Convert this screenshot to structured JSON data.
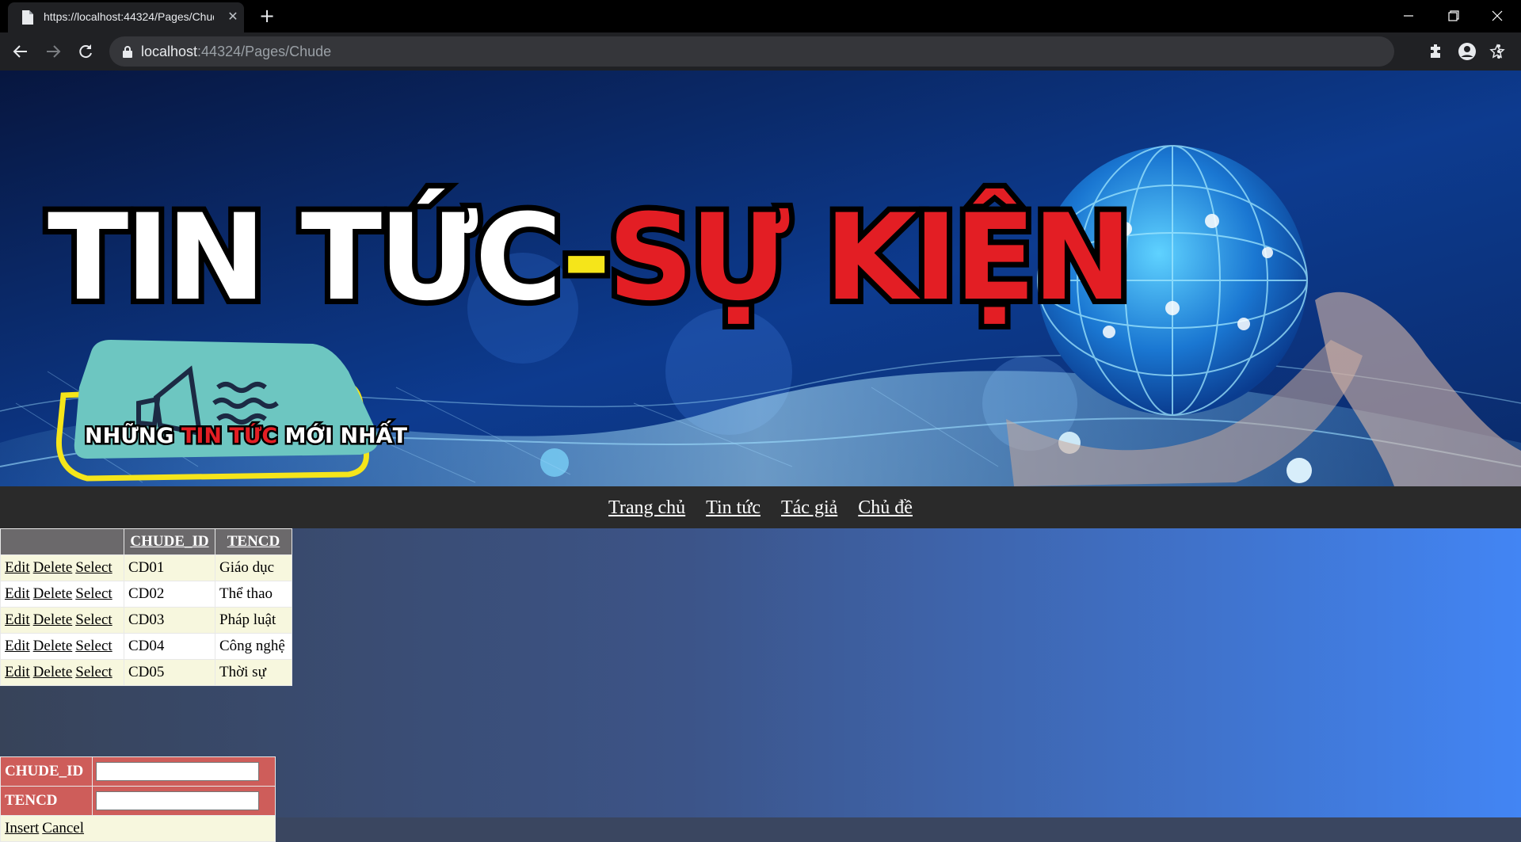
{
  "browser": {
    "tab_title": "https://localhost:44324/Pages/Chude",
    "url_host": "localhost",
    "url_rest": ":44324/Pages/Chude"
  },
  "banner": {
    "title_white": "TIN TỨC",
    "title_dash": "-",
    "title_red": "SỰ KIỆN",
    "badge_white_1": "NHỮNG ",
    "badge_red": "TIN TỨC ",
    "badge_white_2": "MỚI NHẤT",
    "colors": {
      "title_red": "#e31e24",
      "badge_teal": "#6dc6c1",
      "badge_frame": "#f5e51a",
      "bg_dark": "#07163f",
      "bg_mid": "#0d3b8f"
    }
  },
  "nav": {
    "items": [
      "Trang chủ",
      "Tin tức",
      "Tác giả",
      "Chủ đề"
    ]
  },
  "grid": {
    "headers": [
      "CHUDE_ID",
      "TENCD"
    ],
    "actions": [
      "Edit",
      "Delete",
      "Select"
    ],
    "rows": [
      {
        "id": "CD01",
        "name": "Giáo dục"
      },
      {
        "id": "CD02",
        "name": "Thể thao"
      },
      {
        "id": "CD03",
        "name": "Pháp luật"
      },
      {
        "id": "CD04",
        "name": "Công nghệ"
      },
      {
        "id": "CD05",
        "name": "Thời sự"
      }
    ]
  },
  "details": {
    "fields": [
      {
        "label": "CHUDE_ID",
        "value": ""
      },
      {
        "label": "TENCD",
        "value": ""
      }
    ],
    "commands": [
      "Insert",
      "Cancel"
    ]
  }
}
